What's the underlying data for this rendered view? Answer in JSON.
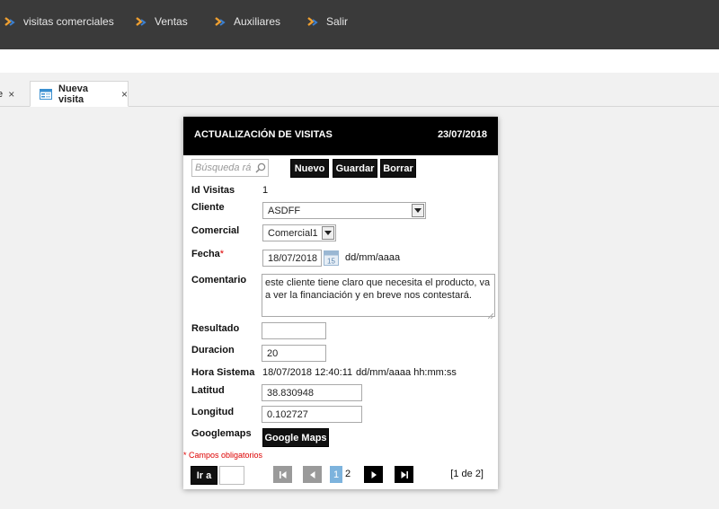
{
  "nav": {
    "items": [
      {
        "label": "visitas comerciales",
        "icon": "arrow-icon"
      },
      {
        "label": "Ventas",
        "icon": "arrow-icon"
      },
      {
        "label": "Auxiliares",
        "icon": "arrow-icon"
      },
      {
        "label": "Salir",
        "icon": "arrow-icon"
      }
    ]
  },
  "tabs": {
    "prev_label": "te",
    "active_label": "Nueva visita",
    "close_glyph": "×"
  },
  "dialog": {
    "title": "ACTUALIZACIÓN DE VISITAS",
    "date": "23/07/2018",
    "search_placeholder": "Búsqueda rá",
    "buttons": {
      "nuevo": "Nuevo",
      "guardar": "Guardar",
      "borrar": "Borrar"
    },
    "fields": {
      "id_label": "Id Visitas",
      "id_value": "1",
      "cliente_label": "Cliente",
      "cliente_value": "ASDFF",
      "comercial_label": "Comercial",
      "comercial_value": "Comercial1",
      "fecha_label": "Fecha",
      "fecha_required": "*",
      "fecha_value": "18/07/2018",
      "fecha_format": "dd/mm/aaaa",
      "comentario_label": "Comentario",
      "comentario_value": "este cliente tiene claro que necesita el producto, va a ver la financiación y en breve nos contestará.",
      "resultado_label": "Resultado",
      "resultado_value": "",
      "duracion_label": "Duracion",
      "duracion_value": "20",
      "hora_label": "Hora Sistema",
      "hora_value": "18/07/2018 12:40:11",
      "hora_format": "dd/mm/aaaa hh:mm:ss",
      "latitud_label": "Latitud",
      "latitud_value": "38.830948",
      "longitud_label": "Longitud",
      "longitud_value": "0.102727",
      "googlemaps_label": "Googlemaps",
      "googlemaps_button": "Google Maps"
    },
    "mandatory_note": "* Campos obligatorios",
    "pager": {
      "goto_label": "Ir a",
      "current_page": "1",
      "other_page": "2",
      "info": "[1 de 2]"
    }
  },
  "colors": {
    "topbar": "#3a3a3a",
    "nav_arrow_blue": "#3a7fd0",
    "nav_arrow_orange": "#f0a030",
    "page_highlight": "#7db3dd",
    "required_red": "#dd0000"
  }
}
